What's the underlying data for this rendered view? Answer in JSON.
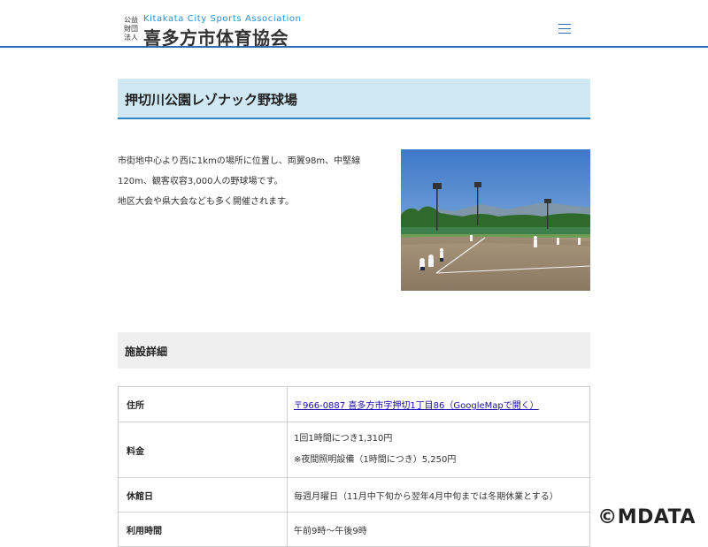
{
  "header": {
    "logo_small_lines": [
      "公益",
      "財団",
      "法人"
    ],
    "logo_en": "Kitakata City Sports Association",
    "logo_ja": "喜多方市体育協会",
    "menu_icon": "hamburger-menu-icon"
  },
  "page": {
    "title": "押切川公園レゾナック野球場"
  },
  "intro": {
    "lines": [
      "市街地中心より西に1kmの場所に位置し、両翼98m、中堅線",
      "120m、観客収容3,000人の野球場です。",
      "地区大会や県大会なども多く開催されます。"
    ]
  },
  "photo": {
    "subject": "baseball-field-photo"
  },
  "details": {
    "heading": "施設詳細",
    "rows": {
      "address": {
        "label": "住所",
        "value": "〒966-0887 喜多方市字押切1丁目86（GoogleMapで開く）"
      },
      "fee": {
        "label": "料金",
        "line1": "1回1時間につき1,310円",
        "line2": "※夜間照明設備（1時間につき）5,250円"
      },
      "closed": {
        "label": "休館日",
        "value": "毎週月曜日（11月中下旬から翌年4月中旬までは冬期休業とする）"
      },
      "hours": {
        "label": "利用時間",
        "value": "午前9時～午後9時"
      }
    }
  },
  "watermark": "©MDATA",
  "colors": {
    "accent_blue": "#2f6db5",
    "title_bg": "#cfe8f3",
    "section_bg": "#efefef",
    "link": "#1a0dab"
  }
}
